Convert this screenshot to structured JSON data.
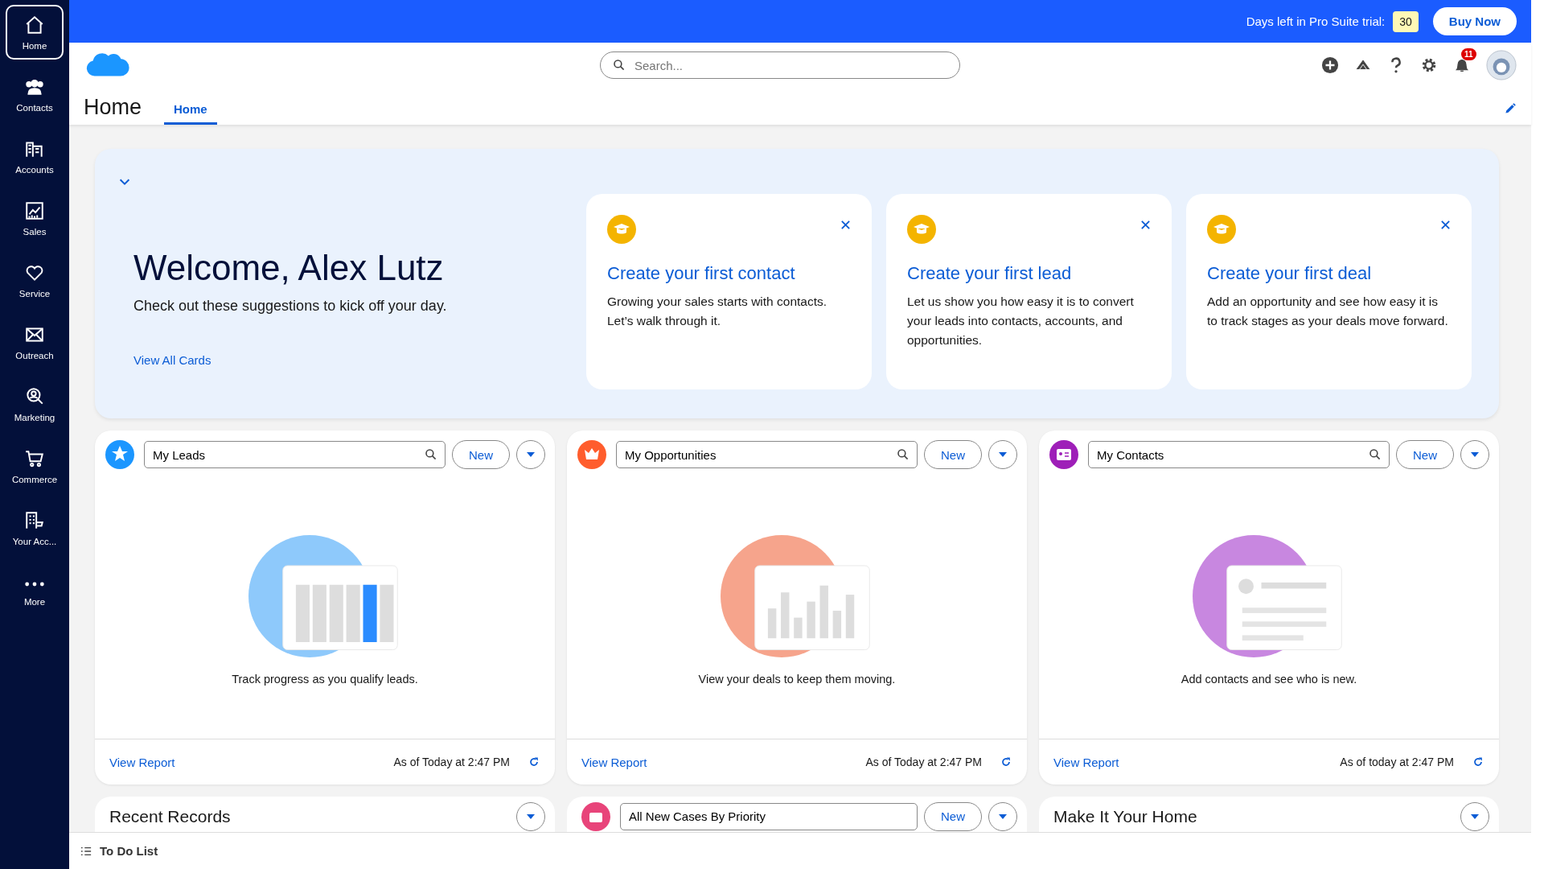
{
  "trial": {
    "label": "Days left in Pro Suite trial:",
    "days": "30",
    "button": "Buy Now"
  },
  "sidebar": {
    "items": [
      {
        "label": "Home",
        "selected": true
      },
      {
        "label": "Contacts",
        "selected": false
      },
      {
        "label": "Accounts",
        "selected": false
      },
      {
        "label": "Sales",
        "selected": false
      },
      {
        "label": "Service",
        "selected": false
      },
      {
        "label": "Outreach",
        "selected": false
      },
      {
        "label": "Marketing",
        "selected": false
      },
      {
        "label": "Commerce",
        "selected": false
      },
      {
        "label": "Your Acc...",
        "selected": false
      },
      {
        "label": "More",
        "selected": false
      }
    ]
  },
  "search": {
    "placeholder": "Search..."
  },
  "notifications": {
    "count": "11"
  },
  "page": {
    "title": "Home",
    "tabs": [
      {
        "label": "Home",
        "selected": true
      }
    ]
  },
  "welcome": {
    "title": "Welcome, Alex Lutz",
    "subtitle": "Check out these suggestions to kick off your day.",
    "link": "View All Cards",
    "suggestions": [
      {
        "title": "Create your first contact",
        "body": "Growing your sales starts with contacts. Let’s walk through it."
      },
      {
        "title": "Create your first lead",
        "body": "Let us show you how easy it is to convert your leads into contacts, accounts, and opportunities."
      },
      {
        "title": "Create your first deal",
        "body": "Add an opportunity and see how easy it is to track stages as your deals move forward."
      }
    ]
  },
  "list_cards": [
    {
      "kind": "leads",
      "color": "#1b96ff",
      "view": "My Leads",
      "button": "New",
      "message": "Track progress as you qualify leads.",
      "link": "View Report",
      "timestamp": "As of Today at 2:47 PM"
    },
    {
      "kind": "opportunities",
      "color": "#ff5d2d",
      "view": "My Opportunities",
      "button": "New",
      "message": "View your deals to keep them moving.",
      "link": "View Report",
      "timestamp": "As of Today at 2:47 PM"
    },
    {
      "kind": "contacts",
      "color": "#9e1fb8",
      "view": "My Contacts",
      "button": "New",
      "message": "Add contacts and see who is new.",
      "link": "View Report",
      "timestamp": "As of today at 2:47 PM"
    }
  ],
  "bottom_cards": [
    {
      "kind": "title",
      "title": "Recent Records"
    },
    {
      "kind": "list",
      "view": "All New Cases By Priority",
      "button": "New"
    },
    {
      "kind": "title",
      "title": "Make It Your Home"
    }
  ],
  "todo": {
    "label": "To Do List"
  }
}
